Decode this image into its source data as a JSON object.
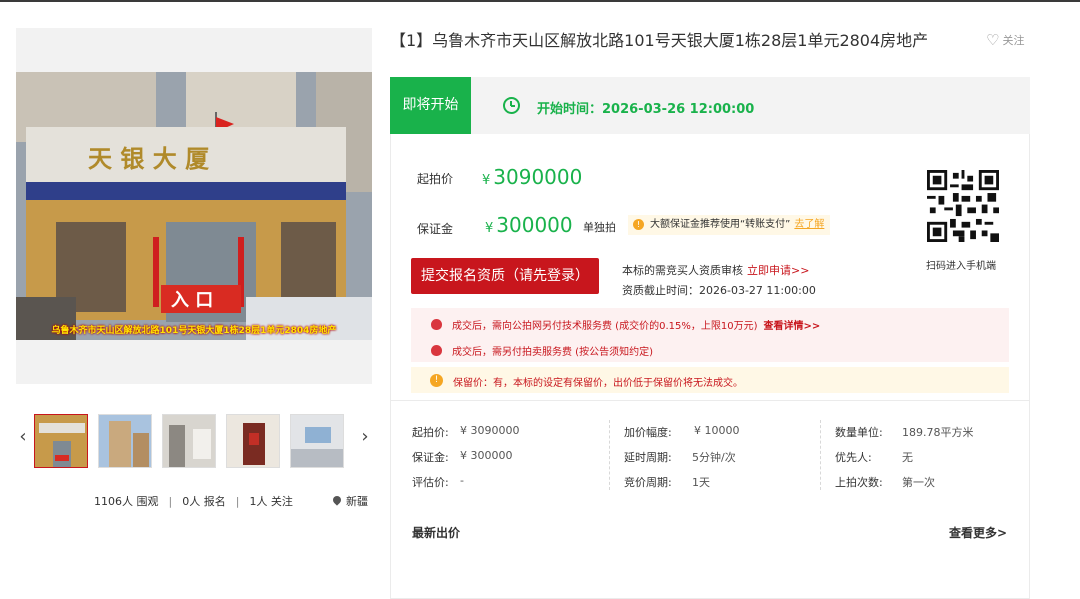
{
  "listing": {
    "title": "【1】乌鲁木齐市天山区解放北路101号天银大厦1栋28层1单元2804房地产",
    "follow_label": "关注",
    "photo_caption": "乌鲁木齐市天山区解放北路101号天银大厦1栋28层1单元2804房地产",
    "photo_sign_text": "天 银 大 厦",
    "photo_entrance_text": "入 口"
  },
  "gallery": {
    "thumbnail_count": 5,
    "active_index": 0
  },
  "stats": {
    "views": "1106人 围观",
    "signups": "0人 报名",
    "follows": "1人 关注",
    "separator": "|",
    "location": "新疆"
  },
  "status": {
    "badge": "即将开始",
    "start_time": "开始时间：2026-03-26 12:00:00"
  },
  "pricing": {
    "start_label": "起拍价",
    "currency": "¥",
    "start_price": "3090000",
    "deposit_label": "保证金",
    "deposit": "300000",
    "single_bid": "单独拍",
    "deposit_tip": "大额保证金推荐使用“转账支付”",
    "deposit_tip_link": "去了解"
  },
  "apply": {
    "button": "提交报名资质（请先登录）",
    "review_text": "本标的需竞买人资质审核",
    "review_link": "立即申请>>",
    "deadline": "资质截止时间：2026-03-27 11:00:00"
  },
  "qr": {
    "caption": "扫码进入手机端"
  },
  "fees": {
    "line1": "成交后，需向公拍网另付技术服务费 (成交价的0.15%，上限10万元)",
    "line1_link": "查看详情>>",
    "line2": "成交后，需另付拍卖服务费 (按公告须知约定)",
    "reserve": "保留价：有，本标的设定有保留价，出价低于保留价将无法成交。"
  },
  "details": {
    "col1": [
      {
        "key": "起拍价:",
        "value": "¥ 3090000"
      },
      {
        "key": "保证金:",
        "value": "¥ 300000"
      },
      {
        "key": "评估价:",
        "value": "-"
      }
    ],
    "col2": [
      {
        "key": "加价幅度:",
        "value": "¥ 10000"
      },
      {
        "key": "延时周期:",
        "value": "5分钟/次"
      },
      {
        "key": "竞价周期:",
        "value": "1天"
      }
    ],
    "col3": [
      {
        "key": "数量单位:",
        "value": "189.78平方米"
      },
      {
        "key": "优先人:",
        "value": "无"
      },
      {
        "key": "上拍次数:",
        "value": "第一次"
      }
    ]
  },
  "bids": {
    "title": "最新出价",
    "more": "查看更多>"
  },
  "colors": {
    "accent_green": "#19b24b",
    "accent_red": "#c8161d",
    "tip_orange": "#f5a623"
  }
}
